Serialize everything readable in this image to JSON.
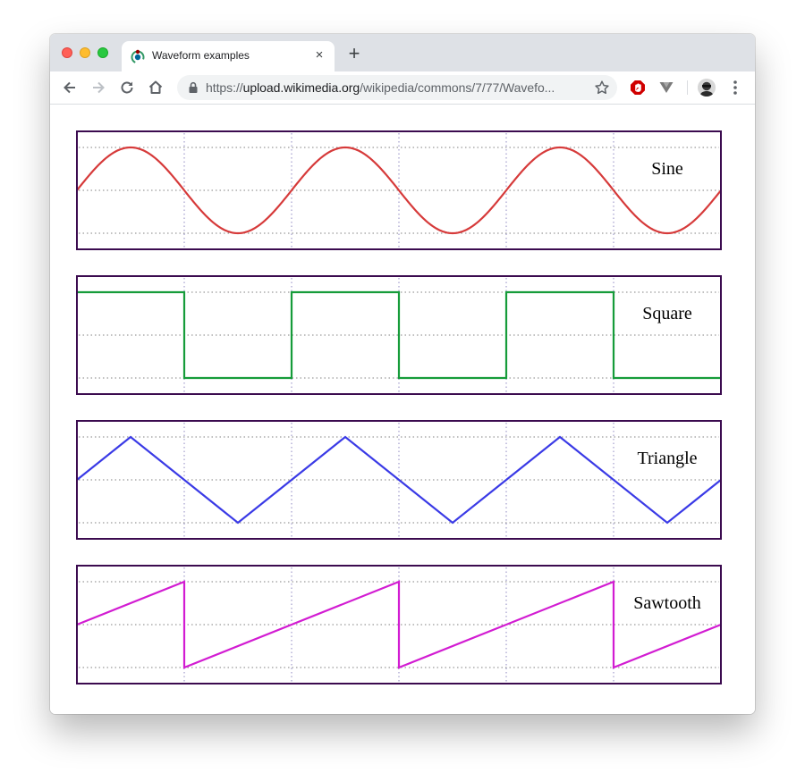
{
  "browser": {
    "tab_title": "Waveform examples",
    "tab_close_glyph": "×",
    "new_tab_glyph": "+",
    "url_scheme": "https://",
    "url_host": "upload.wikimedia.org",
    "url_path": "/wikipedia/commons/7/77/Wavefo...",
    "icons": [
      "back-icon",
      "forward-icon",
      "reload-icon",
      "home-icon",
      "lock-icon",
      "star-icon",
      "adblock-icon",
      "extension-icon",
      "avatar",
      "menu-icon"
    ]
  },
  "waveforms": [
    {
      "label": "Sine",
      "shape": "sine",
      "color": "#d63a3a"
    },
    {
      "label": "Square",
      "shape": "square",
      "color": "#169c3a"
    },
    {
      "label": "Triangle",
      "shape": "triangle",
      "color": "#3a3ae6"
    },
    {
      "label": "Sawtooth",
      "shape": "sawtooth",
      "color": "#d21cd2"
    }
  ],
  "frame_color": "#3b0b4f",
  "cycles_shown": 3,
  "grid": "dotted"
}
